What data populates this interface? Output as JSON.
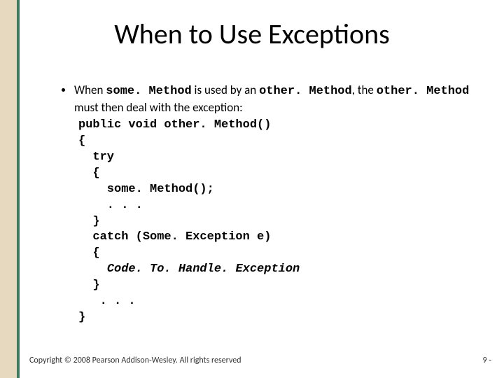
{
  "title": "When to Use Exceptions",
  "bullet": {
    "pre1": "When ",
    "code1": "some. Method",
    "mid1": " is used by an ",
    "code2": "other. Method",
    "mid2": ", the ",
    "code3": "other. Method",
    "post": " must then deal with the exception:"
  },
  "code": {
    "l1": "public void other. Method()",
    "l2": "{",
    "l3": "  try",
    "l4": "  {",
    "l5": "    some. Method();",
    "l6": "    . . .",
    "l7": "  }",
    "l8": "  catch (Some. Exception e)",
    "l9": "  {",
    "l10_indent": "    ",
    "l10_text": "Code. To. Handle. Exception",
    "l11": "  }",
    "l12": "   . . .",
    "l13": "}"
  },
  "footer": {
    "copyright": "Copyright © 2008 Pearson Addison-Wesley. All rights reserved",
    "pagenum": "9 -"
  }
}
